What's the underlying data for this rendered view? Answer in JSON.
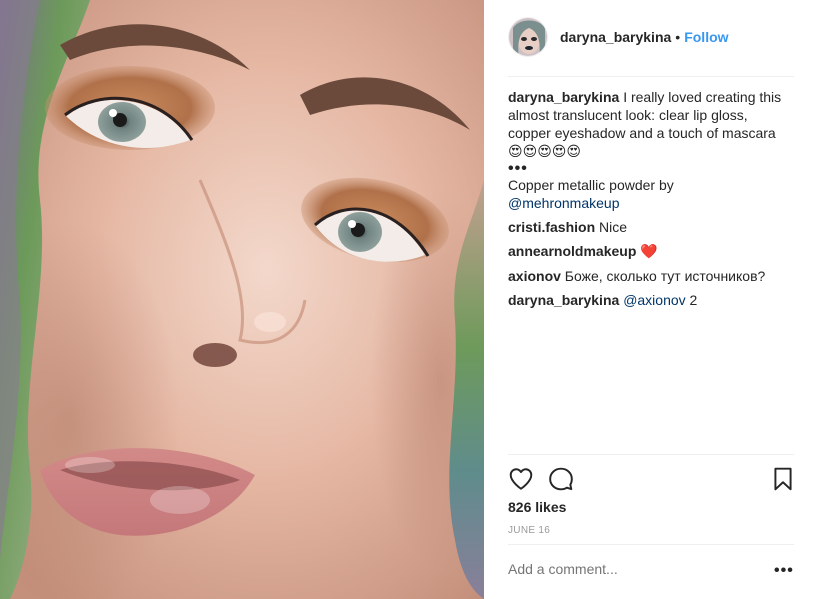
{
  "post": {
    "username": "daryna_barykina",
    "dot": "•",
    "follow_label": "Follow",
    "caption_user": "daryna_barykina",
    "caption_text_1": "I really loved creating this",
    "caption_text_2": "almost translucent look: clear lip gloss,",
    "caption_text_3": "copper eyeshadow and a touch of mascara",
    "caption_emojis": "😍😍😍😍😍",
    "caption_more": "•••",
    "caption_text_4": "Copper metallic powder by",
    "caption_mention": "@mehronmakeup"
  },
  "comments": [
    {
      "user": "cristi.fashion",
      "text": "Nice"
    },
    {
      "user": "annearnoldmakeup",
      "text": "❤️"
    },
    {
      "user": "axionov",
      "text": "Боже, сколько тут источников?"
    },
    {
      "user": "daryna_barykina",
      "mention": "@axionov",
      "text": "2"
    }
  ],
  "actions": {
    "like_icon": "heart-outline-icon",
    "comment_icon": "comment-bubble-icon",
    "save_icon": "bookmark-icon"
  },
  "likes": "826 likes",
  "date": "JUNE 16",
  "add_comment_placeholder": "Add a comment...",
  "options_label": "•••",
  "colors": {
    "follow": "#3897f0",
    "mention": "#003569",
    "text": "#262626",
    "muted": "#999999",
    "divider": "#efefef"
  }
}
